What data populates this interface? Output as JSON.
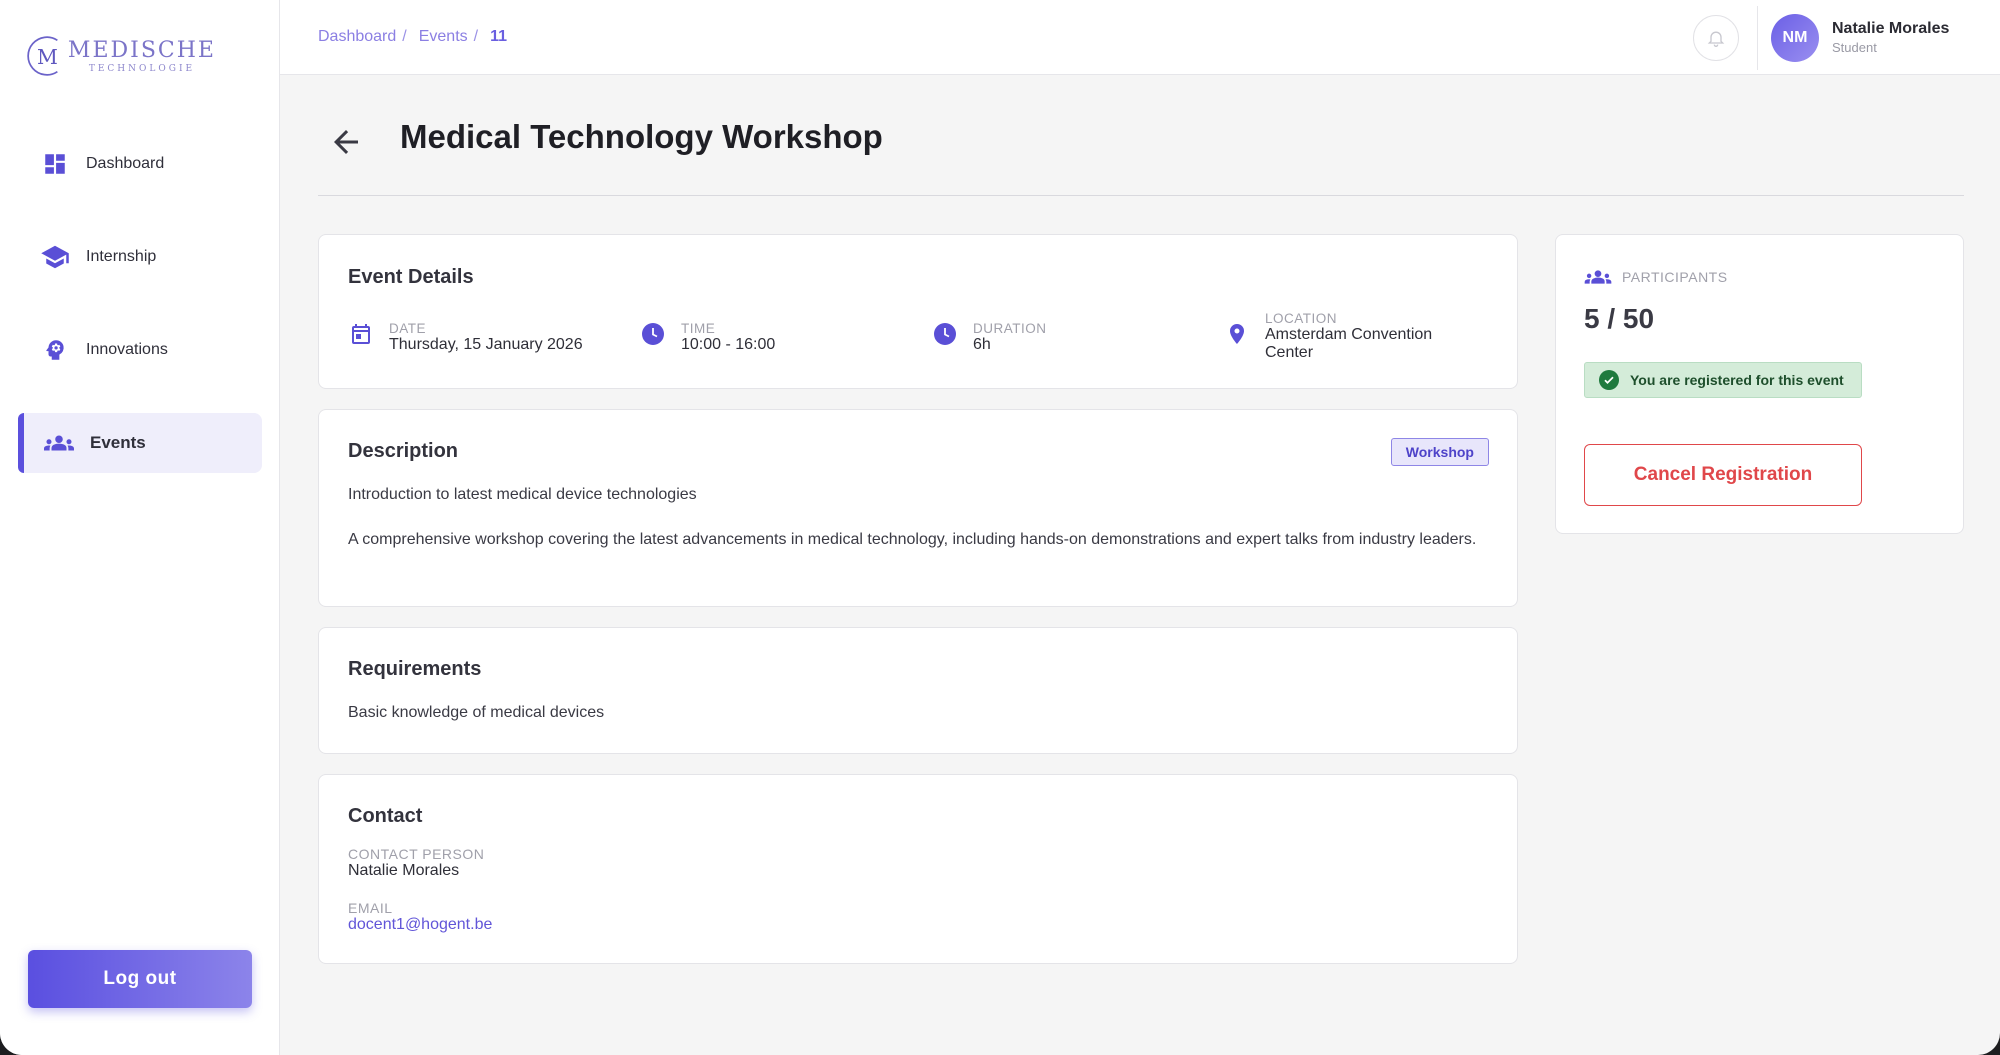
{
  "brand": {
    "name": "MEDISCHE",
    "sub": "TECHNOLOGIE"
  },
  "sidebar": {
    "items": [
      {
        "label": "Dashboard",
        "icon": "dashboard-icon"
      },
      {
        "label": "Internship",
        "icon": "graduation-cap-icon"
      },
      {
        "label": "Innovations",
        "icon": "lightbulb-head-icon"
      },
      {
        "label": "Events",
        "icon": "people-group-icon"
      }
    ],
    "active": "Events",
    "logout_label": "Log out"
  },
  "header": {
    "breadcrumb": [
      "Dashboard",
      "Events",
      "11"
    ],
    "separator": "/",
    "user": {
      "initials": "NM",
      "name": "Natalie Morales",
      "role": "Student"
    }
  },
  "page": {
    "title": "Medical Technology Workshop"
  },
  "event_details": {
    "heading": "Event Details",
    "date": {
      "label": "DATE",
      "value": "Thursday, 15 January 2026"
    },
    "time": {
      "label": "TIME",
      "value": "10:00 - 16:00"
    },
    "duration": {
      "label": "DURATION",
      "value": "6h"
    },
    "location": {
      "label": "LOCATION",
      "value_line1": "Amsterdam Convention",
      "value_line2": "Center"
    }
  },
  "description": {
    "heading": "Description",
    "tag": "Workshop",
    "summary": "Introduction to latest medical device technologies",
    "body": "A comprehensive workshop covering the latest advancements in medical technology, including hands-on demonstrations and expert talks from industry leaders."
  },
  "requirements": {
    "heading": "Requirements",
    "text": "Basic knowledge of medical devices"
  },
  "contact": {
    "heading": "Contact",
    "person_label": "CONTACT PERSON",
    "person": "Natalie Morales",
    "email_label": "EMAIL",
    "email": "docent1@hogent.be"
  },
  "participants": {
    "label": "PARTICIPANTS",
    "count": "5 / 50",
    "registered_text": "You are registered for this event",
    "cancel_label": "Cancel Registration"
  },
  "colors": {
    "accent": "#5b50dd",
    "danger": "#e0474a",
    "success_bg": "#d4ecd9"
  }
}
